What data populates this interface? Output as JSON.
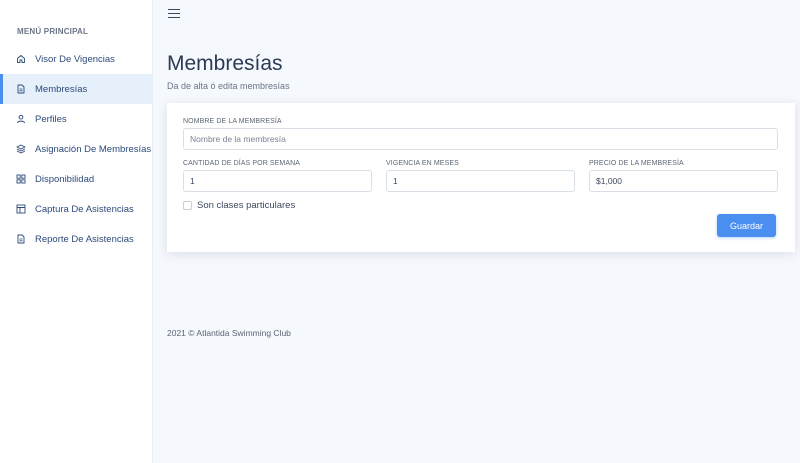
{
  "sidebar": {
    "header": "MENÚ PRINCIPAL",
    "items": [
      {
        "label": "Visor De Vigencias",
        "icon": "home-icon"
      },
      {
        "label": "Membresías",
        "icon": "document-icon",
        "active": true
      },
      {
        "label": "Perfiles",
        "icon": "user-icon"
      },
      {
        "label": "Asignación De Membresías",
        "icon": "layers-icon"
      },
      {
        "label": "Disponibilidad",
        "icon": "grid-icon"
      },
      {
        "label": "Captura De Asistencias",
        "icon": "table-icon"
      },
      {
        "label": "Reporte De Asistencias",
        "icon": "document-icon"
      }
    ]
  },
  "main": {
    "title": "Membresías",
    "subtitle": "Da de alta ó edita membresías",
    "form": {
      "name_label": "NOMBRE DE LA MEMBRESÍA",
      "name_placeholder": "Nombre de la membresía",
      "name_value": "",
      "days_label": "CANTIDAD DE DÍAS POR SEMANA",
      "days_value": "1",
      "validity_label": "VIGENCIA EN MESES",
      "validity_value": "1",
      "price_label": "PRECIO DE LA MEMBRESÍA",
      "price_value": "$1,000",
      "private_classes_label": "Son clases particulares",
      "private_classes_checked": false,
      "save_label": "Guardar"
    }
  },
  "footer": {
    "text": "2021 © Atlantida Swimming Club"
  },
  "colors": {
    "accent": "#4a8ef0",
    "active_bg": "#e6f0fb",
    "page_bg": "#f5f8fc"
  }
}
